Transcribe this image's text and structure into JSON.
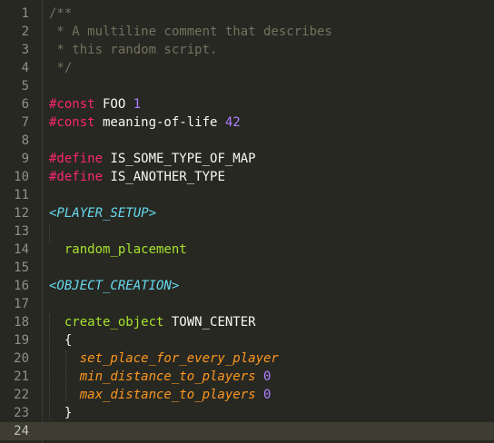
{
  "editor": {
    "colors": {
      "background": "#272822",
      "comment": "#75715e",
      "keyword": "#f92672",
      "number": "#ae81ff",
      "section": "#66d9ef",
      "function": "#a6e22e",
      "attribute": "#fd971f",
      "text": "#f8f8f2"
    },
    "current_line": "24",
    "lines": [
      {
        "n": "1",
        "tokens": [
          {
            "t": "comment",
            "v": "/**"
          }
        ]
      },
      {
        "n": "2",
        "tokens": [
          {
            "t": "comment",
            "v": " * A multiline comment that describes"
          }
        ]
      },
      {
        "n": "3",
        "tokens": [
          {
            "t": "comment",
            "v": " * this random script."
          }
        ]
      },
      {
        "n": "4",
        "tokens": [
          {
            "t": "comment",
            "v": " */"
          }
        ]
      },
      {
        "n": "5",
        "tokens": []
      },
      {
        "n": "6",
        "tokens": [
          {
            "t": "keyword",
            "v": "#const"
          },
          {
            "t": "ident",
            "v": " FOO "
          },
          {
            "t": "number",
            "v": "1"
          }
        ]
      },
      {
        "n": "7",
        "tokens": [
          {
            "t": "keyword",
            "v": "#const"
          },
          {
            "t": "ident",
            "v": " meaning-of-life "
          },
          {
            "t": "number",
            "v": "42"
          }
        ]
      },
      {
        "n": "8",
        "tokens": []
      },
      {
        "n": "9",
        "tokens": [
          {
            "t": "keyword",
            "v": "#define"
          },
          {
            "t": "ident",
            "v": " IS_SOME_TYPE_OF_MAP"
          }
        ]
      },
      {
        "n": "10",
        "tokens": [
          {
            "t": "keyword",
            "v": "#define"
          },
          {
            "t": "ident",
            "v": " IS_ANOTHER_TYPE"
          }
        ]
      },
      {
        "n": "11",
        "tokens": []
      },
      {
        "n": "12",
        "tokens": [
          {
            "t": "section",
            "v": "<PLAYER_SETUP>"
          }
        ]
      },
      {
        "n": "13",
        "tokens": []
      },
      {
        "n": "14",
        "tokens": [
          {
            "t": "ident",
            "v": "  "
          },
          {
            "t": "func",
            "v": "random_placement"
          }
        ]
      },
      {
        "n": "15",
        "tokens": []
      },
      {
        "n": "16",
        "tokens": [
          {
            "t": "section",
            "v": "<OBJECT_CREATION>"
          }
        ]
      },
      {
        "n": "17",
        "tokens": []
      },
      {
        "n": "18",
        "tokens": [
          {
            "t": "ident",
            "v": "  "
          },
          {
            "t": "func",
            "v": "create_object"
          },
          {
            "t": "ident",
            "v": " TOWN_CENTER"
          }
        ]
      },
      {
        "n": "19",
        "tokens": [
          {
            "t": "ident",
            "v": "  {"
          }
        ]
      },
      {
        "n": "20",
        "tokens": [
          {
            "t": "ident",
            "v": "    "
          },
          {
            "t": "attr",
            "v": "set_place_for_every_player"
          }
        ]
      },
      {
        "n": "21",
        "tokens": [
          {
            "t": "ident",
            "v": "    "
          },
          {
            "t": "attr",
            "v": "min_distance_to_players"
          },
          {
            "t": "ident",
            "v": " "
          },
          {
            "t": "number",
            "v": "0"
          }
        ]
      },
      {
        "n": "22",
        "tokens": [
          {
            "t": "ident",
            "v": "    "
          },
          {
            "t": "attr",
            "v": "max_distance_to_players"
          },
          {
            "t": "ident",
            "v": " "
          },
          {
            "t": "number",
            "v": "0"
          }
        ]
      },
      {
        "n": "23",
        "tokens": [
          {
            "t": "ident",
            "v": "  }"
          }
        ]
      },
      {
        "n": "24",
        "tokens": []
      }
    ]
  }
}
